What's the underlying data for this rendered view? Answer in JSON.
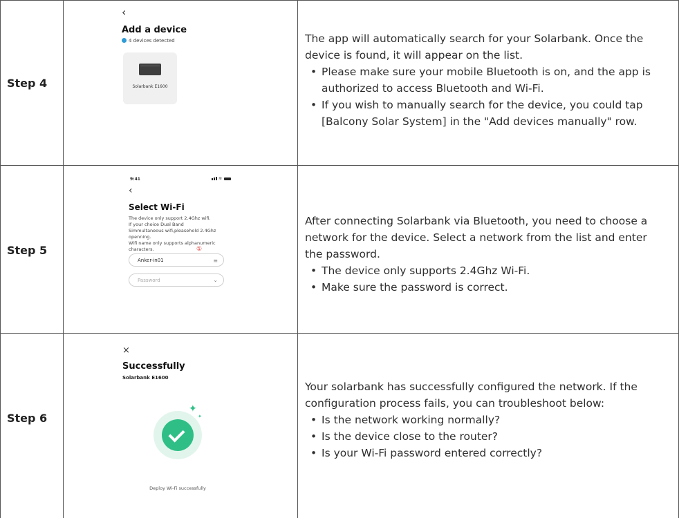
{
  "steps": [
    {
      "label": "Step 4",
      "screen": {
        "back_icon": "chevron-left-icon",
        "title": "Add a device",
        "detected": "4 devices detected",
        "device_name": "Solarbank E1600"
      },
      "intro": "The app will automatically search for your Solarbank. Once the device is found, it will appear on the list.",
      "bullets": [
        "Please make sure your mobile Bluetooth is on, and the app is authorized to access Bluetooth and Wi-Fi.",
        "If you wish to manually search for the device, you could tap [Balcony Solar System] in the \"Add devices manually\" row."
      ]
    },
    {
      "label": "Step 5",
      "screen": {
        "time": "9:41",
        "back_icon": "chevron-left-icon",
        "title": "Select Wi-Fi",
        "info": "The device only support 2.4Ghz wifi.\nIf your choice Dual Band Simmultaneous wifi,pleasehold 2.4Ghz openning.\nWifi name only supports alphanumeric characters.",
        "marker": "①",
        "network_value": "Anker-in01",
        "password_placeholder": "Password"
      },
      "intro": "After connecting Solarbank via Bluetooth, you need to choose a network for the device. Select a network from the list and enter the password.",
      "bullets": [
        "The device only supports 2.4Ghz Wi-Fi.",
        "Make sure the password is correct."
      ]
    },
    {
      "label": "Step 6",
      "screen": {
        "close_icon": "close-icon",
        "title": "Successfully",
        "subtitle": "Solarbank E1600",
        "status": "Deploy Wi-Fi successfully"
      },
      "intro": "Your solarbank has successfully configured the network. If the configuration process fails, you can troubleshoot below:",
      "bullets": [
        "Is the network working normally?",
        "Is the device close to the router?",
        "Is your Wi-Fi password entered correctly?"
      ]
    }
  ],
  "colors": {
    "grid": "#555555",
    "accent_green": "#2fbf86",
    "accent_blue": "#2e9bd6",
    "marker_red": "#e0332f"
  }
}
